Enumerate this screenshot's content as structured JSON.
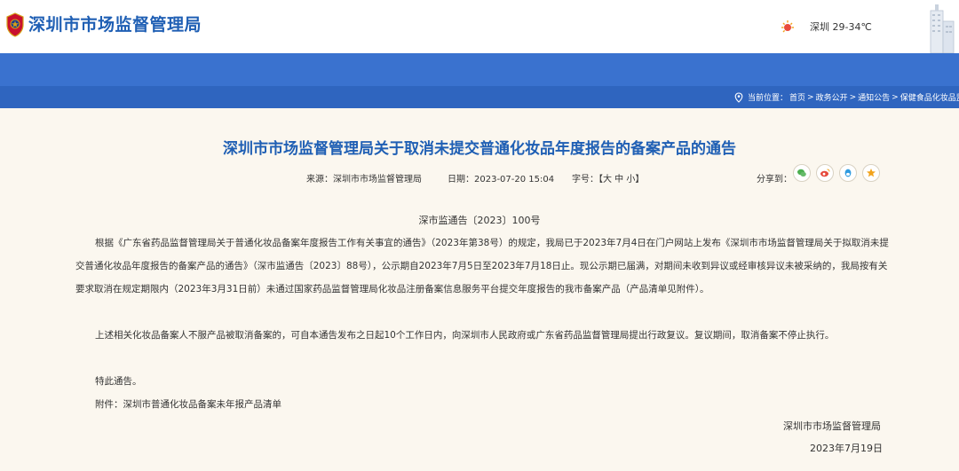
{
  "header": {
    "site_title": "深圳市市场监督管理局",
    "weather": "深圳 29-34℃"
  },
  "breadcrumb": {
    "prefix": "当前位置：",
    "items": [
      "首页",
      "政务公开",
      "通知公告",
      "保健食品化妆品监管"
    ],
    "separator": ">"
  },
  "article": {
    "title": "深圳市市场监督管理局关于取消未提交普通化妆品年度报告的备案产品的通告",
    "source_label": "来源：",
    "source": "深圳市市场监督管理局",
    "date_label": "日期：",
    "date": "2023-07-20 15:04",
    "font_label": "字号：",
    "font_sizes": "【大 中 小】",
    "share_label": "分享到：",
    "share_icons": [
      "wechat-icon",
      "weibo-icon",
      "qq-icon",
      "favorite-icon"
    ],
    "doc_number": "深市监通告〔2023〕100号",
    "paragraph1": "根据《广东省药品监督管理局关于普通化妆品备案年度报告工作有关事宜的通告》（2023年第38号）的规定，我局已于2023年7月4日在门户网站上发布《深圳市市场监督管理局关于拟取消未提交普通化妆品年度报告的备案产品的通告》（深市监通告〔2023〕88号），公示期自2023年7月5日至2023年7月18日止。现公示期已届满，对期间未收到异议或经审核异议未被采纳的，我局按有关要求取消在规定期限内（2023年3月31日前）未通过国家药品监督管理局化妆品注册备案信息服务平台提交年度报告的我市备案产品（产品清单见附件）。",
    "paragraph2": "上述相关化妆品备案人不服产品被取消备案的，可自本通告发布之日起10个工作日内，向深圳市人民政府或广东省药品监督管理局提出行政复议。复议期间，取消备案不停止执行。",
    "paragraph3": "特此通告。",
    "attachment": "附件：深圳市普通化妆品备案未年报产品清单",
    "signature_org": "深圳市市场监督管理局",
    "signature_date": "2023年7月19日"
  },
  "colors": {
    "brand_blue": "#1f5fb4",
    "band_blue": "#3a72cf",
    "content_bg": "#fbf7ef"
  }
}
